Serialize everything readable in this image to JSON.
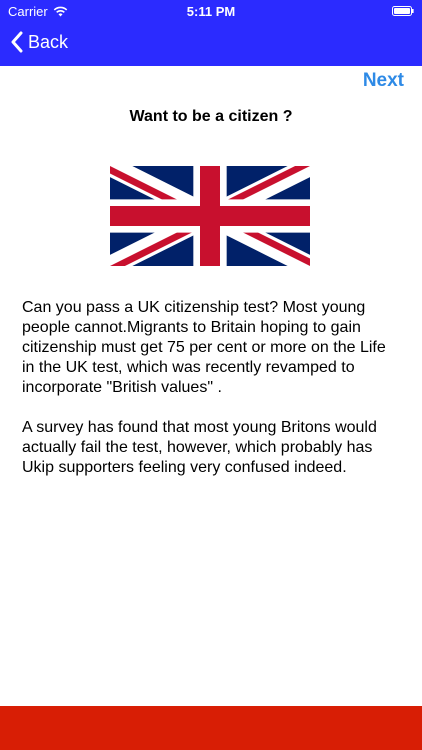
{
  "status_bar": {
    "carrier": "Carrier",
    "time": "5:11 PM",
    "icons": [
      "wifi-icon",
      "battery-icon"
    ]
  },
  "nav": {
    "back_label": "Back",
    "back_icon": "chevron-left-icon",
    "next_label": "Next"
  },
  "content": {
    "title": "Want to be a citizen ?",
    "flag_icon": "union-jack-flag",
    "paragraph_1": "Can you pass a UK citizenship test? Most young people cannot.Migrants to Britain hoping to gain citizenship must get 75 per cent or more on the Life in the UK test, which was recently revamped to incorporate \"British values\" .",
    "paragraph_2": "A survey has found that most young Britons would actually fail the test, however, which probably has Ukip supporters feeling very confused indeed."
  },
  "colors": {
    "header_bg": "#2b2bff",
    "next_text": "#2e8ae6",
    "bottom_bar": "#d81e05",
    "flag_blue": "#012169",
    "flag_red": "#C8102E"
  }
}
